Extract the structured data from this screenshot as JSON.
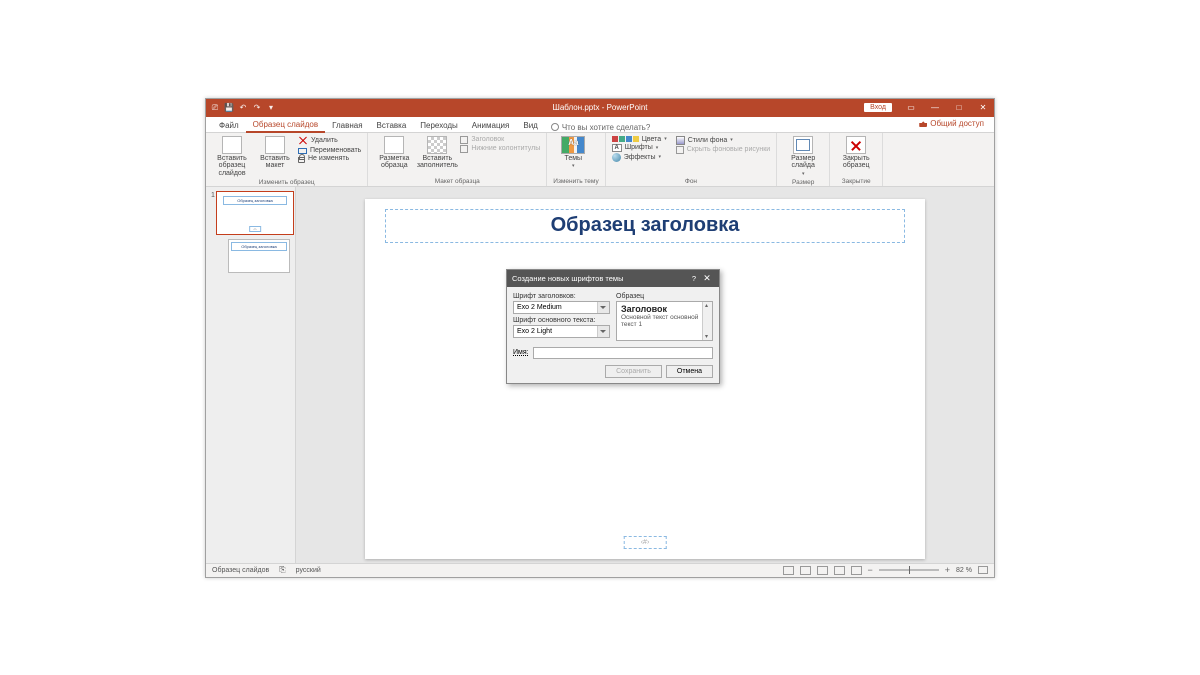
{
  "titlebar": {
    "title": "Шаблон.pptx - PowerPoint",
    "signin": "Вход"
  },
  "tabs": {
    "file": "Файл",
    "slideMaster": "Образец слайдов",
    "home": "Главная",
    "insert": "Вставка",
    "transitions": "Переходы",
    "animations": "Анимация",
    "view": "Вид",
    "tellMe": "Что вы хотите сделать?",
    "share": "Общий доступ"
  },
  "ribbon": {
    "editMaster": {
      "insertSlideMaster": "Вставить образец слайдов",
      "insertLayout": "Вставить макет",
      "delete": "Удалить",
      "rename": "Переименовать",
      "preserve": "Не изменять",
      "groupLabel": "Изменить образец"
    },
    "masterLayout": {
      "masterLayout": "Разметка образца",
      "insertPlaceholder": "Вставить заполнитель",
      "title": "Заголовок",
      "footers": "Нижние колонтитулы",
      "groupLabel": "Макет образца"
    },
    "editTheme": {
      "themes": "Темы",
      "groupLabel": "Изменить тему"
    },
    "background": {
      "colors": "Цвета",
      "fonts": "Шрифты",
      "effects": "Эффекты",
      "bgStyles": "Стили фона",
      "hideBgGraphics": "Скрыть фоновые рисунки",
      "groupLabel": "Фон"
    },
    "size": {
      "slideSize": "Размер слайда",
      "groupLabel": "Размер"
    },
    "close": {
      "closeMaster": "Закрыть образец",
      "groupLabel": "Закрытие"
    }
  },
  "slide": {
    "titlePlaceholder": "Образец заголовка",
    "pageNumber": "‹#›",
    "thumbTitle": "Образец заголовка"
  },
  "dialog": {
    "title": "Создание новых шрифтов темы",
    "headingFontLabel": "Шрифт заголовков:",
    "headingFont": "Exo 2 Medium",
    "bodyFontLabel": "Шрифт основного текста:",
    "bodyFont": "Exo 2 Light",
    "sampleLabel": "Образец",
    "sampleHeading": "Заголовок",
    "sampleBody": "Основной текст основной текст 1",
    "nameLabel": "Имя:",
    "nameValue": "",
    "save": "Сохранить",
    "cancel": "Отмена"
  },
  "statusbar": {
    "mode": "Образец слайдов",
    "lang": "русский",
    "zoom": "82 %"
  }
}
